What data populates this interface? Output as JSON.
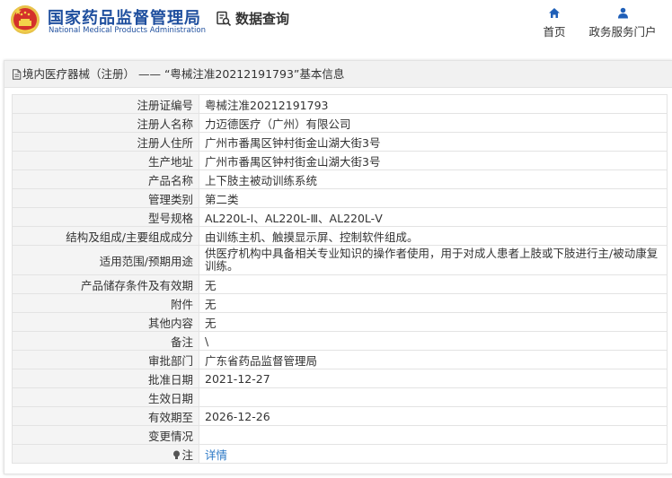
{
  "site": {
    "name_cn": "国家药品监督管理局",
    "name_en": "National Medical Products Administration",
    "page_name": "数据查询"
  },
  "nav": {
    "home": "首页",
    "gov": "政务服务门户"
  },
  "breadcrumb": "境内医疗器械（注册） —— “粤械注准20212191793”基本信息",
  "rows": [
    {
      "label": "注册证编号",
      "value": "粤械注准20212191793"
    },
    {
      "label": "注册人名称",
      "value": "力迈德医疗（广州）有限公司"
    },
    {
      "label": "注册人住所",
      "value": "广州市番禺区钟村街金山湖大街3号"
    },
    {
      "label": "生产地址",
      "value": "广州市番禺区钟村街金山湖大街3号"
    },
    {
      "label": "产品名称",
      "value": "上下肢主被动训练系统"
    },
    {
      "label": "管理类别",
      "value": "第二类"
    },
    {
      "label": "型号规格",
      "value": "AL220L-Ⅰ、AL220L-Ⅲ、AL220L-Ⅴ"
    },
    {
      "label": "结构及组成/主要组成成分",
      "value": "由训练主机、触摸显示屏、控制软件组成。"
    },
    {
      "label": "适用范围/预期用途",
      "value": "供医疗机构中具备相关专业知识的操作者使用，用于对成人患者上肢或下肢进行主/被动康复训练。"
    },
    {
      "label": "产品储存条件及有效期",
      "value": "无"
    },
    {
      "label": "附件",
      "value": "无"
    },
    {
      "label": "其他内容",
      "value": "无"
    },
    {
      "label": "备注",
      "value": "\\"
    },
    {
      "label": "审批部门",
      "value": "广东省药品监督管理局"
    },
    {
      "label": "批准日期",
      "value": "2021-12-27"
    },
    {
      "label": "生效日期",
      "value": ""
    },
    {
      "label": "有效期至",
      "value": "2026-12-26"
    },
    {
      "label": "变更情况",
      "value": ""
    },
    {
      "label": "注",
      "value": "详情"
    }
  ],
  "colors": {
    "brand_blue": "#1f4f9e",
    "link_blue": "#2b78c5"
  }
}
